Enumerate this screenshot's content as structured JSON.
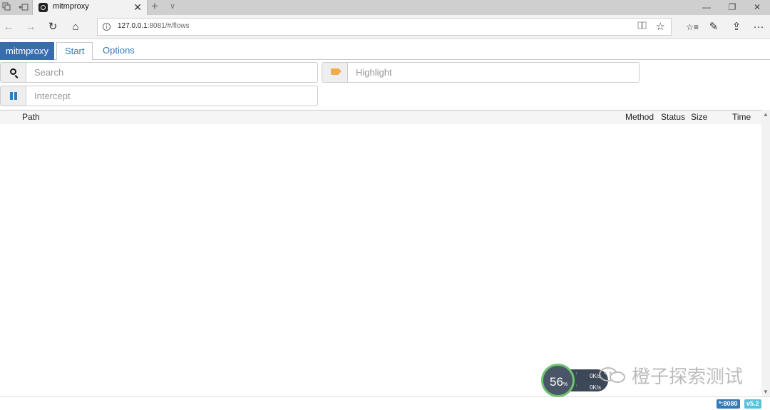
{
  "browser": {
    "tab_title": "mitmproxy",
    "tab_close": "✕",
    "new_tab": "+",
    "tab_menu": "∨",
    "url_host": "127.0.0.1",
    "url_rest": ":8081/#/flows",
    "window_controls": {
      "minimize": "—",
      "restore": "❐",
      "close": "✕"
    },
    "nav": {
      "back": "←",
      "forward": "→",
      "refresh": "↻",
      "home": "⌂",
      "more": "···"
    },
    "toolbar": {
      "favorites": "☆≡",
      "notes": "✎",
      "share": "⇪"
    }
  },
  "app": {
    "brand": "mitmproxy",
    "tabs": [
      "Start",
      "Options"
    ],
    "active_tab": "Start",
    "filters": {
      "search_placeholder": "Search",
      "highlight_placeholder": "Highlight",
      "intercept_placeholder": "Intercept"
    },
    "columns": [
      "Path",
      "Method",
      "Status",
      "Size",
      "Time"
    ],
    "flows": [],
    "footer": {
      "listen_badge": "*:8080",
      "version_badge": "v5.2"
    },
    "colors": {
      "brand": "#396cad",
      "link": "#337ab7",
      "highlight_icon": "#f0ad4e",
      "listen_badge": "#337ab7",
      "version_badge": "#5bc0de"
    }
  },
  "overlay": {
    "net_meter": {
      "percent": "56",
      "percent_unit": "%",
      "up_rate": "0K/s",
      "down_rate": "0K/s"
    },
    "watermark_text": "橙子探索测试"
  }
}
